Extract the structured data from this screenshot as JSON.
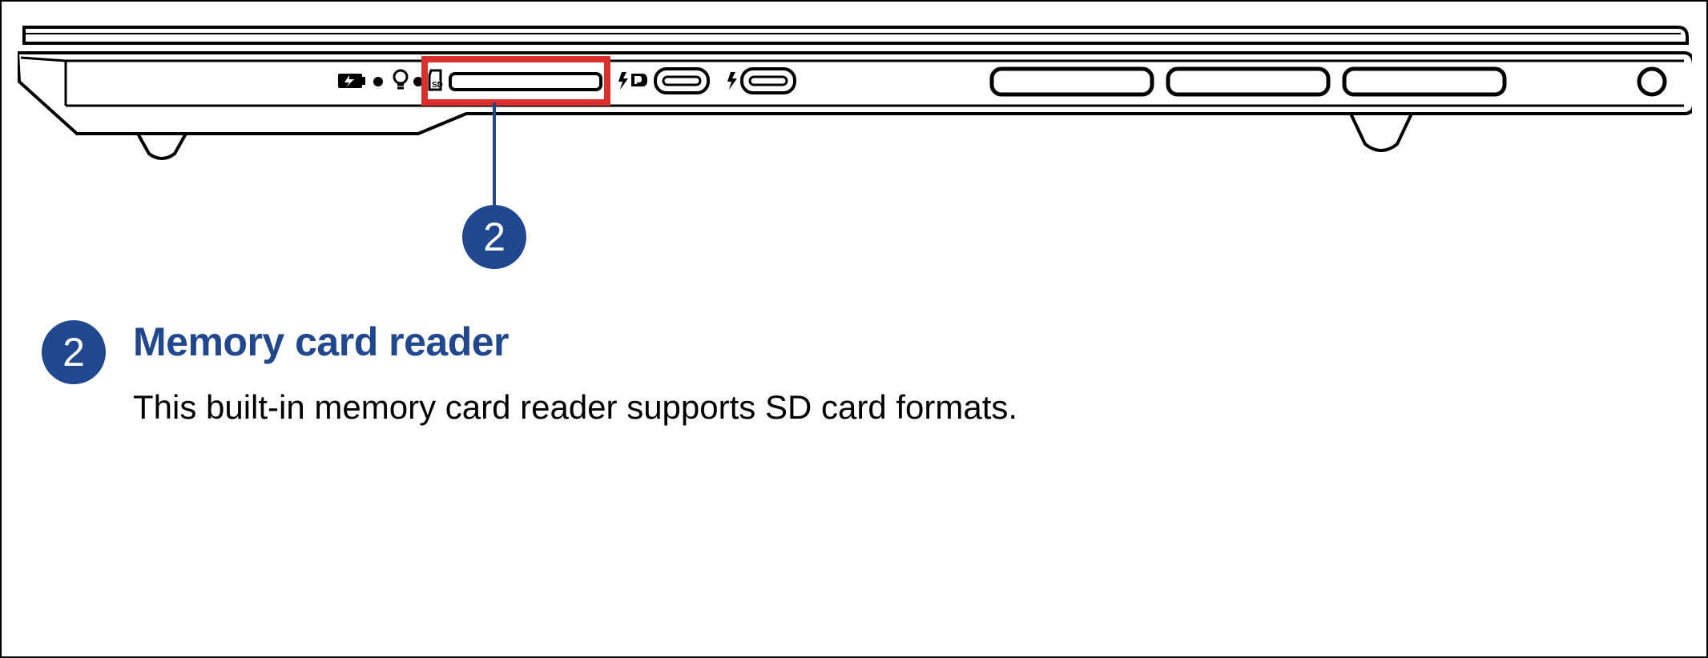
{
  "callout": {
    "number": "2"
  },
  "description": {
    "number": "2",
    "title": "Memory card reader",
    "body": "This built-in memory card reader supports SD card formats."
  },
  "icons": {
    "sd_label": "SD"
  }
}
